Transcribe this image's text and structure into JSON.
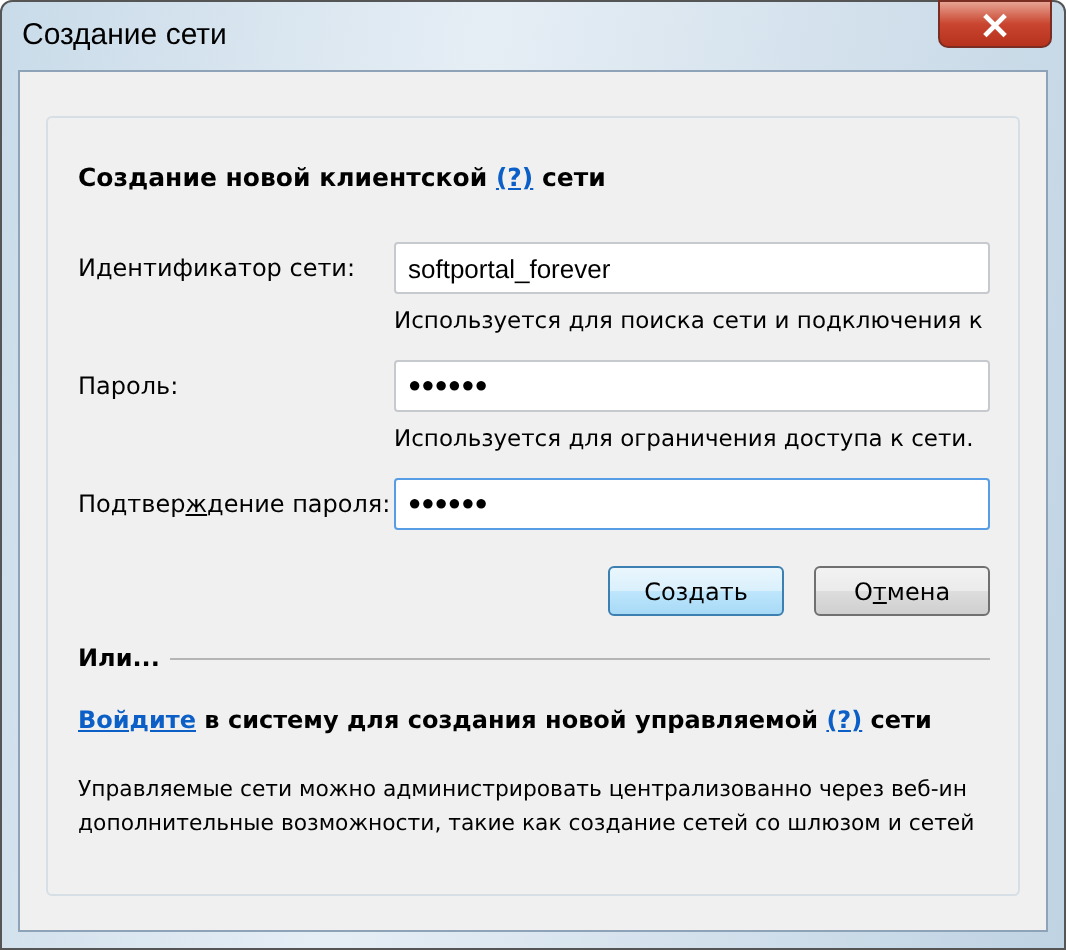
{
  "window": {
    "title": "Создание сети",
    "close": "×"
  },
  "heading_parts": [
    {
      "text": "Создание новой клиентской ",
      "kind": "text"
    },
    {
      "text": "(?)",
      "kind": "link"
    },
    {
      "text": " сети",
      "kind": "text"
    }
  ],
  "fields": [
    {
      "kind": "text",
      "label_parts": [
        {
          "text": "Идентификатор сети:",
          "kind": "text"
        }
      ],
      "value": "softportal_forever",
      "focused": false,
      "hint": "Используется для поиска сети и подключения к"
    },
    {
      "kind": "password",
      "label_parts": [
        {
          "text": "Пароль:",
          "kind": "text"
        }
      ],
      "value": "●●●●●●",
      "focused": false,
      "hint": "Используется для ограничения доступа к сети."
    },
    {
      "kind": "password",
      "label_parts": [
        {
          "text": "Подтвер",
          "kind": "text"
        },
        {
          "text": "ж",
          "kind": "accesskey"
        },
        {
          "text": "дение пароля:",
          "kind": "text"
        }
      ],
      "value": "●●●●●●",
      "focused": true
    }
  ],
  "buttons": [
    {
      "label_parts": [
        {
          "text": "Создать",
          "kind": "text"
        }
      ],
      "default": true
    },
    {
      "label_parts": [
        {
          "text": "О",
          "kind": "text"
        },
        {
          "text": "т",
          "kind": "accesskey"
        },
        {
          "text": "мена",
          "kind": "text"
        }
      ],
      "default": false
    }
  ],
  "or_section": {
    "title": "Или...",
    "login_parts": [
      {
        "text": "Войдите",
        "kind": "link"
      },
      {
        "text": " в систему для создания новой управляемой ",
        "kind": "text"
      },
      {
        "text": "(?)",
        "kind": "link"
      },
      {
        "text": " сети",
        "kind": "text"
      }
    ],
    "description_lines": [
      "Управляемые сети можно администрировать централизованно через веб-ин",
      "дополнительные возможности, такие как создание сетей со шлюзом и сетей"
    ]
  }
}
